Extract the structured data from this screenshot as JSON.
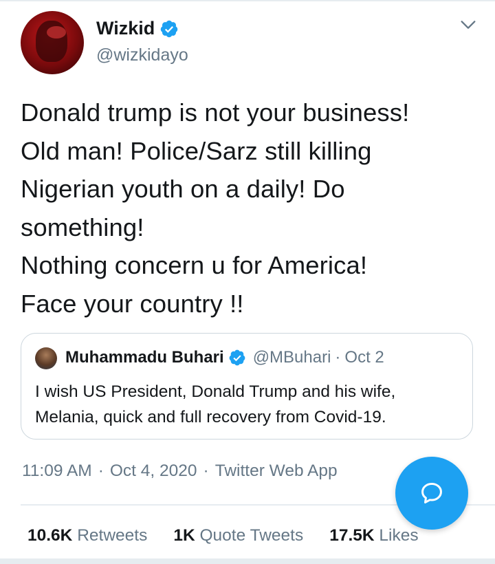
{
  "author": {
    "name": "Wizkid",
    "handle": "@wizkidayo",
    "verified_icon": "verified-badge-icon"
  },
  "tweet": {
    "lines": [
      "Donald trump is not your business!",
      "Old man! Police/Sarz still killing",
      "Nigerian youth on a daily! Do",
      "something!",
      "Nothing concern u for America!",
      "Face your country !!"
    ]
  },
  "quoted": {
    "name": "Muhammadu Buhari",
    "handle": "@MBuhari",
    "dot": "·",
    "date": "Oct 2",
    "lines": [
      "I wish US President, Donald Trump and his wife,",
      "Melania, quick and full recovery from Covid-19."
    ]
  },
  "meta": {
    "time": "11:09 AM",
    "sep1": "·",
    "date": "Oct 4, 2020",
    "sep2": "·",
    "source": "Twitter Web App"
  },
  "stats": {
    "retweets_count": "10.6K",
    "retweets_label": "Retweets",
    "quotes_count": "1K",
    "quotes_label": "Quote Tweets",
    "likes_count": "17.5K",
    "likes_label": "Likes"
  },
  "colors": {
    "accent": "#1da1f2",
    "text": "#14171a",
    "secondary": "#657786",
    "border": "#ccd6dd"
  }
}
